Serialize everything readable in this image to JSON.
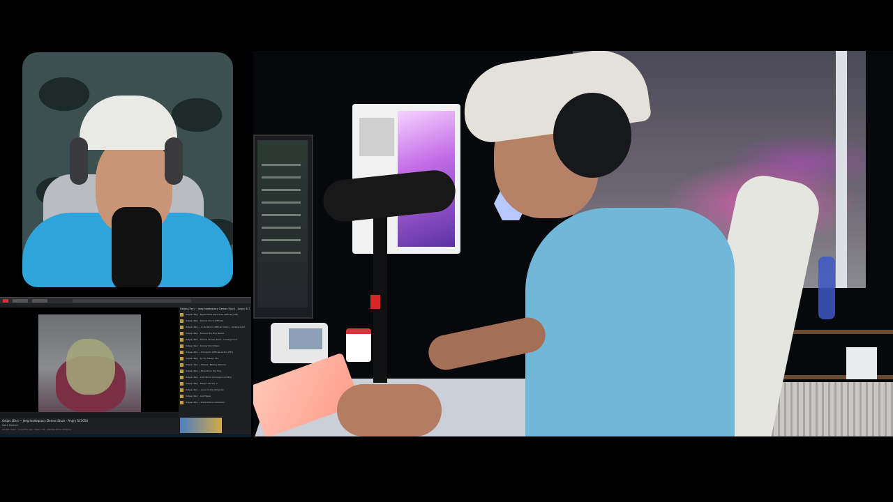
{
  "layout": {
    "facecam": {
      "label": ""
    },
    "screen_capture": {
      "browser_tabs": [],
      "video": {
        "title": "Ostjas (Zer) ~ Jeeg Inadequacy Demos Stuck - Angry SC5050",
        "channel": "Saint Nomad",
        "description": "23,040 views · 3 months ago · Deep cuts · #Ostjas #rare #hiphop"
      },
      "chat_header": "Ostjas (Zer) ~ Jeeg Inadequacy Demos Stuck - Angry SC5050",
      "chat_items": [
        "Ostjas (Zer) - Nightmares Dark Side (Official) [HD]",
        "Ostjas (Zer) - Demos Stuck (Official)",
        "Ostjas (Zer) ~ In Da Room (Official Video) - Underground",
        "Ostjas (Zer) - Forever Hip Hop Remix",
        "Ostjas (Zer) - Demos Lemon Slack - Underground",
        "Ostjas (Zer) - Demos Stuck Rare",
        "Ostjas (Zer) ~ Hologram (Official Audio) [HD]",
        "Ostjas (Zer) - So Fly Classic Mix",
        "Ostjas (Zer) ~ Where I Belong (Remix)",
        "Ostjas (Zer) ~ Blue Moon Hip Hop",
        "Ostjas (Zer) - Cold World (Underground Mix)",
        "Ostjas (Zer) - Deep Cuts Vol. 2",
        "Ostjas (Zer) ~ Gone Crazy (Original)",
        "Ostjas (Zer) - Lost Tapes",
        "Ostjas (Zer) ~ Rare Demos Collection"
      ]
    }
  },
  "colors": {
    "background": "#000000",
    "facecam_bg": "#3c5052",
    "shirt": "#2fa4da",
    "accent_light": "#d46cff"
  }
}
